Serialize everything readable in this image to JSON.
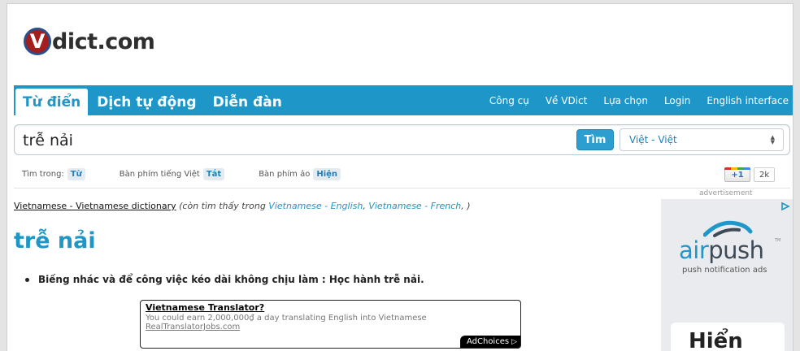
{
  "logo": {
    "mark": "V",
    "text": "dict.com"
  },
  "nav": {
    "tabs": [
      {
        "label": "Từ điển",
        "active": true
      },
      {
        "label": "Dịch tự động",
        "active": false
      },
      {
        "label": "Diễn đàn",
        "active": false
      }
    ],
    "links": [
      "Công cụ",
      "Về VDict",
      "Lựa chọn",
      "Login",
      "English interface"
    ]
  },
  "search": {
    "value": "trễ nải",
    "button_label": "Tìm",
    "dictionary": "Việt - Việt"
  },
  "options": {
    "search_in_label": "Tìm trong:",
    "search_in_value": "Từ",
    "keyboard_label": "Bàn phím tiếng Việt",
    "keyboard_value": "Tắt",
    "virtual_keyboard_label": "Bàn phím ảo",
    "virtual_keyboard_value": "Hiện"
  },
  "gplus": {
    "label": "+1",
    "count": "2k"
  },
  "result": {
    "dictionary_name": "Vietnamese - Vietnamese dictionary",
    "also_found_prefix": "(còn tìm thấy trong ",
    "also_found_links": [
      "Vietnamese - English",
      "Vietnamese - French"
    ],
    "also_found_suffix": ", )",
    "headword": "trễ nải",
    "definitions": [
      "Biếng nhác và để công việc kéo dài không chịu làm : Học hành trễ nải."
    ]
  },
  "text_ad": {
    "title": "Vietnamese Translator?",
    "description": "You could earn 2,000,000₫ a day translating English into Vietnamese",
    "url": "RealTranslatorJobs.com",
    "adchoices": "AdChoices"
  },
  "side_ad": {
    "label": "advertisement",
    "brand_air": "air",
    "brand_push": "push",
    "trademark": "TM",
    "tagline": "push notification ads",
    "bottom_text": "Hiển"
  },
  "colors": {
    "brand_blue": "#1e96c8",
    "logo_red": "#a51d1d"
  }
}
